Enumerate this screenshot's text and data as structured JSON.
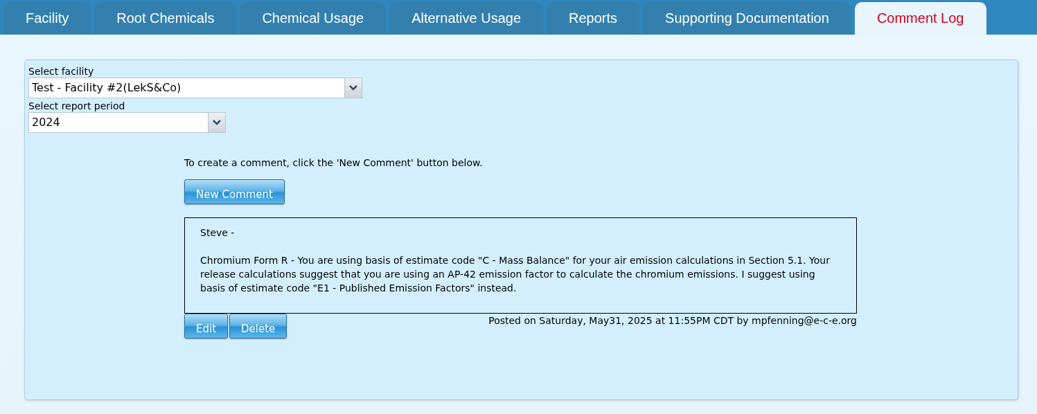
{
  "tabs": [
    {
      "label": "Facility",
      "selected": false
    },
    {
      "label": "Root Chemicals",
      "selected": false
    },
    {
      "label": "Chemical Usage",
      "selected": false
    },
    {
      "label": "Alternative Usage",
      "selected": false
    },
    {
      "label": "Reports",
      "selected": false
    },
    {
      "label": "Supporting Documentation",
      "selected": false
    },
    {
      "label": "Comment Log",
      "selected": true
    }
  ],
  "facility_select": {
    "label": "Select facility",
    "value": "Test - Facility #2(LekS&Co)"
  },
  "period_select": {
    "label": "Select report period",
    "value": "2024"
  },
  "instructions": "To create a comment, click the 'New Comment' button below.",
  "new_comment_button": "New Comment",
  "comments": [
    {
      "greeting": "Steve -",
      "body": "Chromium Form R - You are using basis of estimate code \"C - Mass Balance\" for your air emission calculations in Section 5.1. Your release calculations suggest that you are using an AP-42 emission factor to calculate the chromium emissions. I suggest using basis of estimate code \"E1 - Published Emission Factors\" instead.",
      "actions": [
        "Edit",
        "Delete"
      ],
      "posted": "Posted on Saturday, May31, 2025 at 11:55PM CDT by mpfenning@e-c-e.org"
    }
  ]
}
